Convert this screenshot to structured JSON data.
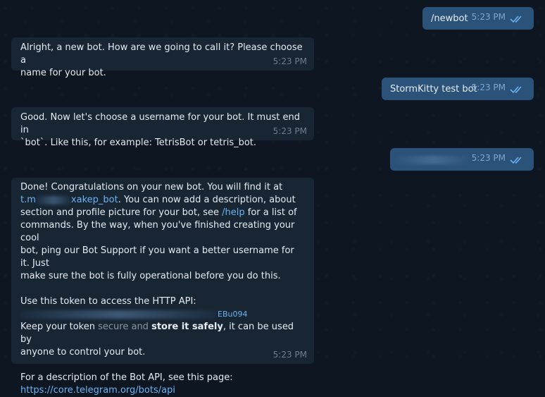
{
  "colors": {
    "background": "#0e1621",
    "incoming_bubble": "#182533",
    "outgoing_bubble": "#2b5278",
    "link": "#6ab3f3",
    "time_in": "#6d7f8f",
    "time_out": "#7da8d3"
  },
  "messages": [
    {
      "direction": "out",
      "text": "/newbot",
      "time": "5:23 PM",
      "status_icon": "double-check-icon"
    },
    {
      "direction": "in",
      "line1": "Alright, a new bot. How are we going to call it? Please choose a",
      "line2": "name for your bot.",
      "time": "5:23 PM"
    },
    {
      "direction": "out",
      "text": "StormKitty test bot",
      "time": "5:23 PM",
      "status_icon": "double-check-icon"
    },
    {
      "direction": "in",
      "line1": "Good. Now let's choose a username for your bot. It must end in",
      "line2": "`bot`. Like this, for example: TetrisBot or tetris_bot.",
      "time": "5:23 PM"
    },
    {
      "direction": "out",
      "text": "",
      "time": "5:23 PM",
      "status_icon": "double-check-icon",
      "redacted": true
    },
    {
      "direction": "in",
      "line1": "Done! Congratulations on your new bot. You will find it at",
      "bot_link_start": "t.m",
      "bot_link_end": "xakep_bot",
      "line2_rest": ". You can now add a description, about",
      "line3": "section and profile picture for your bot, see",
      "help_link": "/help",
      "line3_rest": "for a list of",
      "line4": "commands. By the way, when you've finished creating your cool",
      "line5": "bot, ping our Bot Support if you want a better username for it. Just",
      "line6": "make sure the bot is fully operational before you do this.",
      "token_label": "Use this token to access the HTTP API:",
      "token_end": "EBu094",
      "keep_a": "Keep your token",
      "keep_b": "secure and",
      "keep_bold": "store it safely",
      "keep_c": ", it can be used by",
      "keep_line2": "anyone to control your bot.",
      "api_desc": "For a description of the Bot API, see this page:",
      "api_link": "https://core.telegram.org/bots/api",
      "time": "5:23 PM"
    }
  ]
}
